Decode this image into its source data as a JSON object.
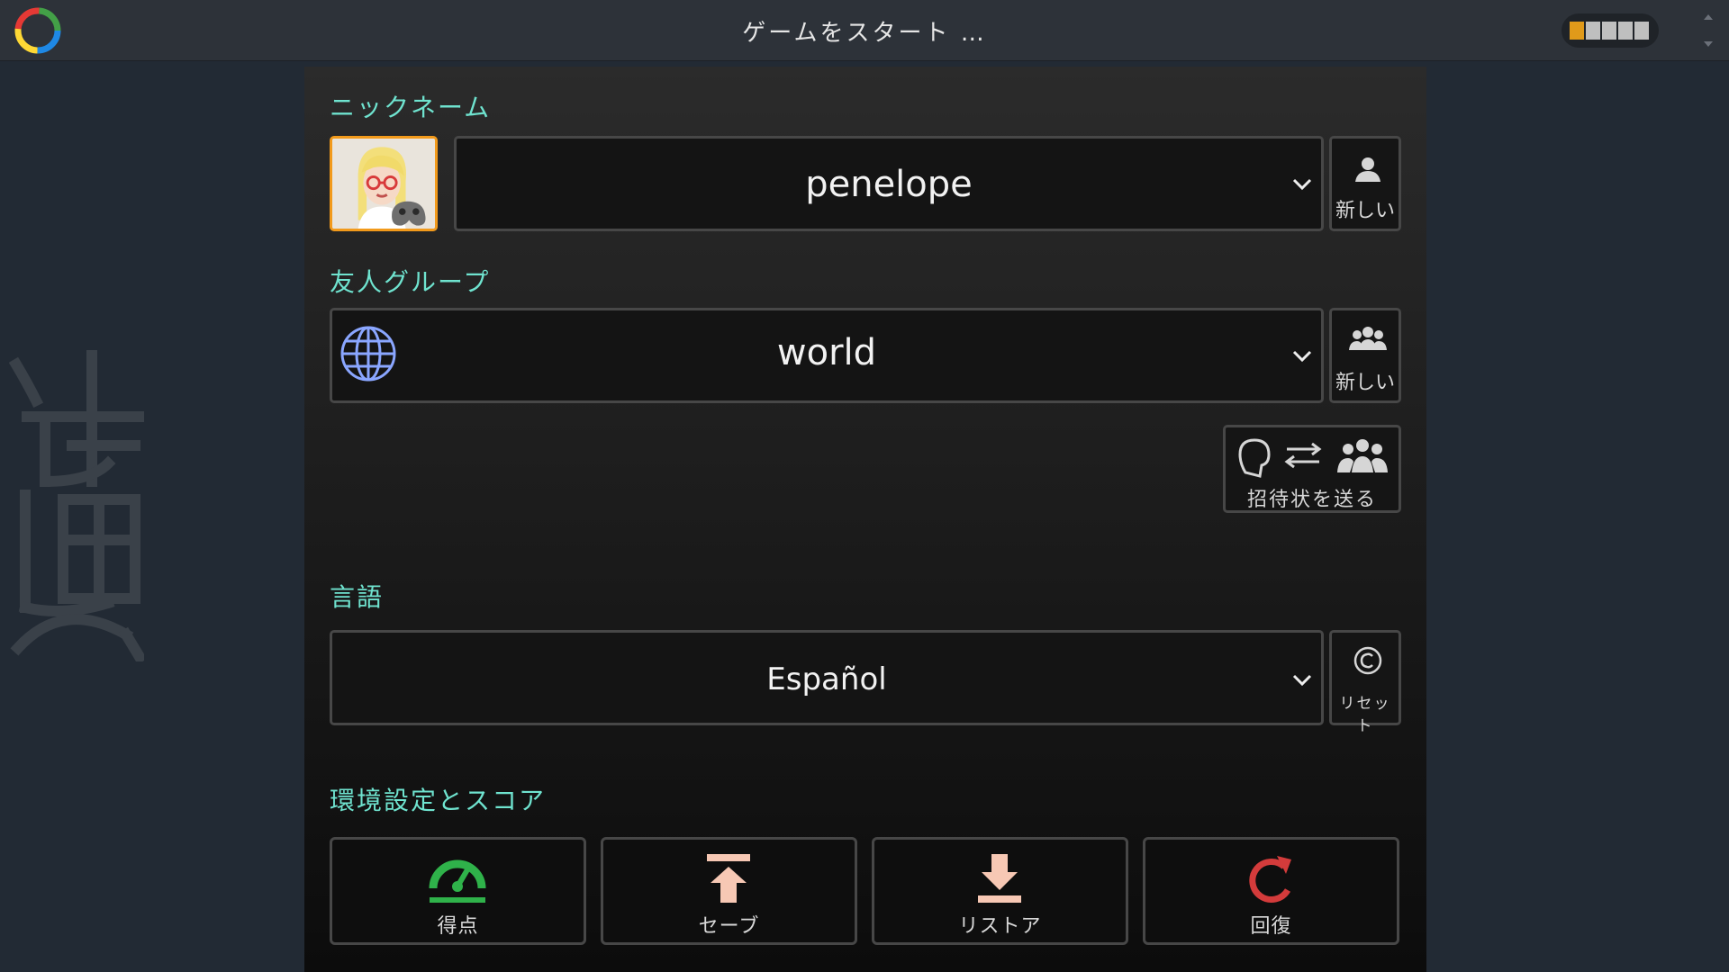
{
  "topbar": {
    "title": "ゲームをスタート …",
    "progress": {
      "filled": 1,
      "total": 5
    }
  },
  "nickname": {
    "label": "ニックネーム",
    "value": "penelope",
    "new_label": "新しい"
  },
  "friends": {
    "label": "友人グループ",
    "value": "world",
    "new_label": "新しい",
    "invite_label": "招待状を送る"
  },
  "language": {
    "label": "言語",
    "value": "Español",
    "reset_label": "リセット"
  },
  "settings": {
    "label": "環境設定とスコア",
    "buttons": [
      {
        "label": "得点",
        "icon": "speedometer-icon",
        "color": "#2fb24a"
      },
      {
        "label": "セーブ",
        "icon": "upload-icon",
        "color": "#f7c8b4"
      },
      {
        "label": "リストア",
        "icon": "download-icon",
        "color": "#f7c8b4"
      },
      {
        "label": "回復",
        "icon": "refresh-icon",
        "color": "#d33b3b"
      }
    ]
  },
  "colors": {
    "accent": "#6fe3cf",
    "avatar_border": "#f29a1b"
  }
}
